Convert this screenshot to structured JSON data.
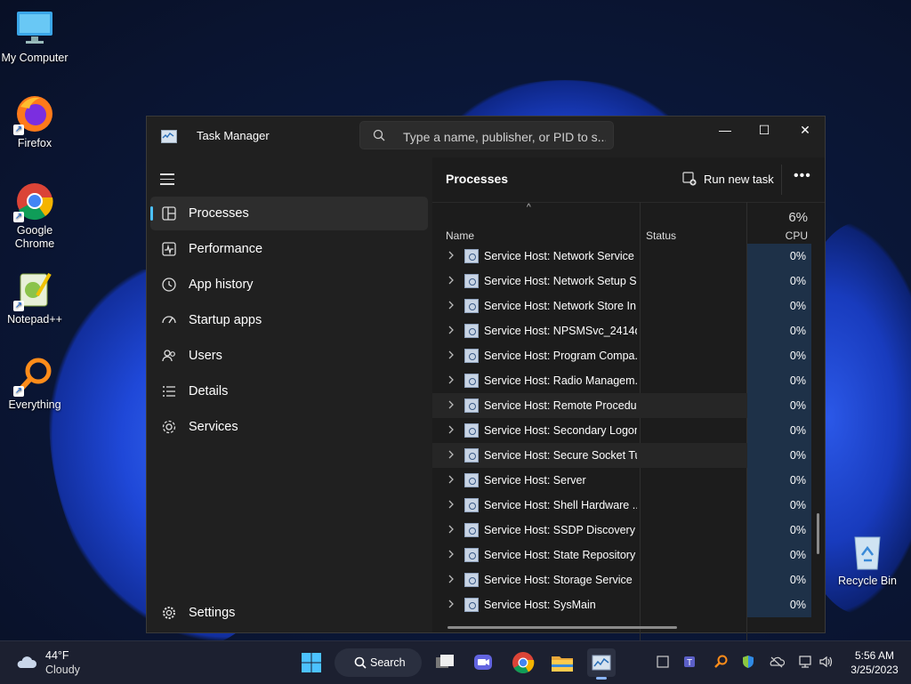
{
  "desktop": {
    "icons": [
      {
        "label": "My Computer",
        "icon": "monitor-icon"
      },
      {
        "label": "Firefox",
        "icon": "firefox-icon"
      },
      {
        "label": "Google Chrome",
        "icon": "chrome-icon"
      },
      {
        "label": "Notepad++",
        "icon": "notepadpp-icon"
      },
      {
        "label": "Everything",
        "icon": "everything-search-icon"
      },
      {
        "label": "Recycle Bin",
        "icon": "recycle-bin-icon"
      }
    ]
  },
  "window": {
    "title": "Task Manager",
    "search_placeholder": "Type a name, publisher, or PID to s...",
    "controls": {
      "minimize": "—",
      "maximize": "☐",
      "close": "✕"
    }
  },
  "sidebar": {
    "items": [
      {
        "label": "Processes",
        "icon": "processes-icon",
        "active": true
      },
      {
        "label": "Performance",
        "icon": "performance-icon"
      },
      {
        "label": "App history",
        "icon": "history-icon"
      },
      {
        "label": "Startup apps",
        "icon": "startup-icon"
      },
      {
        "label": "Users",
        "icon": "users-icon"
      },
      {
        "label": "Details",
        "icon": "details-icon"
      },
      {
        "label": "Services",
        "icon": "services-icon"
      }
    ],
    "settings_label": "Settings"
  },
  "main": {
    "title": "Processes",
    "run_new_task": "Run new task",
    "more": "•••",
    "columns": {
      "name": "Name",
      "status": "Status",
      "cpu_percent": "6%",
      "cpu": "CPU"
    },
    "rows": [
      {
        "name": "Service Host: Network Service",
        "cpu": "0%"
      },
      {
        "name": "Service Host: Network Setup S...",
        "cpu": "0%"
      },
      {
        "name": "Service Host: Network Store In...",
        "cpu": "0%"
      },
      {
        "name": "Service Host: NPSMSvc_2414d",
        "cpu": "0%"
      },
      {
        "name": "Service Host: Program Compa...",
        "cpu": "0%"
      },
      {
        "name": "Service Host: Radio Managem...",
        "cpu": "0%"
      },
      {
        "name": "Service Host: Remote Procedu...",
        "cpu": "0%",
        "hover": true
      },
      {
        "name": "Service Host: Secondary Logon",
        "cpu": "0%"
      },
      {
        "name": "Service Host: Secure Socket Tu...",
        "cpu": "0%",
        "hover": true
      },
      {
        "name": "Service Host: Server",
        "cpu": "0%"
      },
      {
        "name": "Service Host: Shell Hardware ...",
        "cpu": "0%"
      },
      {
        "name": "Service Host: SSDP Discovery",
        "cpu": "0%"
      },
      {
        "name": "Service Host: State Repository ...",
        "cpu": "0%"
      },
      {
        "name": "Service Host: Storage Service",
        "cpu": "0%"
      },
      {
        "name": "Service Host: SysMain",
        "cpu": "0%"
      }
    ]
  },
  "taskbar": {
    "weather": {
      "temp": "44°F",
      "condition": "Cloudy"
    },
    "search_label": "Search",
    "time": "5:56 AM",
    "date": "3/25/2023"
  },
  "colors": {
    "accent": "#4cc2ff",
    "cpu_cell": "#1e3148",
    "window_bg": "#202020"
  }
}
